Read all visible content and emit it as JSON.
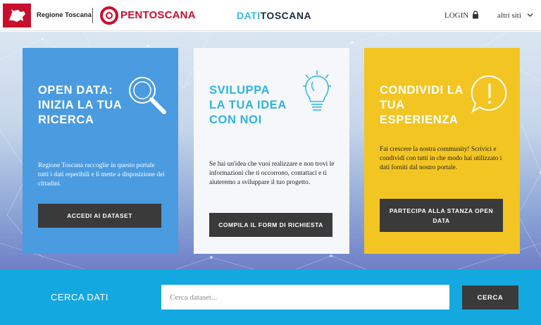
{
  "header": {
    "regione_label": "Regione Toscana",
    "opentoscana_label": "PENTOSCANA",
    "brand_part1": "DATI",
    "brand_part2": "TOSCANA",
    "login_label": "LOGIN",
    "other_sites_label": "altri siti"
  },
  "cards": [
    {
      "title": "OPEN DATA: INIZIA LA TUA RICERCA",
      "text": "Regione Toscana raccoglie in questo portale tutti i dati reperibili e li mette a disposizione dei cittadini.",
      "button": "ACCEDI AI DATASET",
      "icon": "magnifier-icon"
    },
    {
      "title": "SVILUPPA LA TUA IDEA CON NOI",
      "text": "Se hai un'idea che vuoi realizzare e non trovi le informazioni che ti occorrono, contattaci e ti aiuteremo a sviluppare il tuo progetto.",
      "button": "COMPILA IL FORM DI RICHIESTA",
      "icon": "lightbulb-icon"
    },
    {
      "title": "CONDIVIDI LA TUA ESPERIENZA",
      "text": "Fai crescere la nostra community! Scrivici e condividi con tutti in che modo hai utilizzato i dati forniti dal nostro portale.",
      "button": "PARTECIPA ALLA STANZA OPEN DATA",
      "icon": "exclamation-bubble-icon"
    }
  ],
  "search": {
    "label": "CERCA DATI",
    "placeholder": "Cerca dataset...",
    "button": "CERCA"
  },
  "colors": {
    "brand_red": "#c8102e",
    "brand_blue": "#2dbce9",
    "card_blue": "#4a9be0",
    "card_white": "#f5f7fb",
    "card_yellow": "#f3c522",
    "button_dark": "#3a3a3a",
    "search_bar": "#14a8e0"
  }
}
